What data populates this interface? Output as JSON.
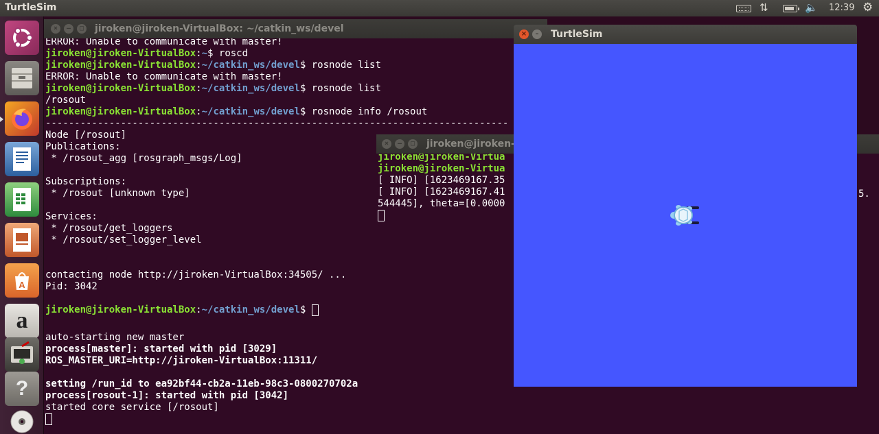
{
  "top_panel": {
    "app_title": "TurtleSim",
    "clock": "12:39"
  },
  "launcher": {
    "items": [
      {
        "name": "ubuntu-dash-icon"
      },
      {
        "name": "files-icon"
      },
      {
        "name": "firefox-icon"
      },
      {
        "name": "writer-icon"
      },
      {
        "name": "calc-icon"
      },
      {
        "name": "impress-icon"
      },
      {
        "name": "software-center-icon"
      },
      {
        "name": "amazon-icon"
      },
      {
        "name": "system-settings-icon"
      },
      {
        "name": "help-icon"
      },
      {
        "name": "dvd-icon"
      }
    ],
    "amazon_glyph": "a",
    "help_glyph": "?"
  },
  "terminal_main": {
    "title": "jiroken@jiroken-VirtualBox: ~/catkin_ws/devel",
    "user_host": "jiroken@jiroken-VirtualBox",
    "lines": [
      {
        "type": "text",
        "text": "ERROR: Unable to communicate with master!"
      },
      {
        "type": "prompt",
        "path": "~",
        "cmd": " roscd"
      },
      {
        "type": "prompt",
        "path": "~/catkin_ws/devel",
        "cmd": " rosnode list"
      },
      {
        "type": "text",
        "text": "ERROR: Unable to communicate with master!"
      },
      {
        "type": "prompt",
        "path": "~/catkin_ws/devel",
        "cmd": " rosnode list"
      },
      {
        "type": "text",
        "text": "/rosout"
      },
      {
        "type": "prompt",
        "path": "~/catkin_ws/devel",
        "cmd": " rosnode info /rosout"
      },
      {
        "type": "text",
        "text": "--------------------------------------------------------------------------------"
      },
      {
        "type": "text",
        "text": "Node [/rosout]"
      },
      {
        "type": "text",
        "text": "Publications:"
      },
      {
        "type": "text",
        "text": " * /rosout_agg [rosgraph_msgs/Log]"
      },
      {
        "type": "text",
        "text": ""
      },
      {
        "type": "text",
        "text": "Subscriptions:"
      },
      {
        "type": "text",
        "text": " * /rosout [unknown type]"
      },
      {
        "type": "text",
        "text": ""
      },
      {
        "type": "text",
        "text": "Services:"
      },
      {
        "type": "text",
        "text": " * /rosout/get_loggers"
      },
      {
        "type": "text",
        "text": " * /rosout/set_logger_level"
      },
      {
        "type": "text",
        "text": ""
      },
      {
        "type": "text",
        "text": ""
      },
      {
        "type": "text",
        "text": "contacting node http://jiroken-VirtualBox:34505/ ..."
      },
      {
        "type": "text",
        "text": "Pid: 3042"
      },
      {
        "type": "text",
        "text": ""
      },
      {
        "type": "prompt-cursor",
        "path": "~/catkin_ws/devel",
        "cmd": " "
      }
    ]
  },
  "terminal_roscore": {
    "lines": [
      {
        "type": "text",
        "text": "auto-starting new master"
      },
      {
        "type": "bold",
        "text": "process[master]: started with pid [3029]"
      },
      {
        "type": "bold",
        "text": "ROS_MASTER_URI=http://jiroken-VirtualBox:11311/"
      },
      {
        "type": "text",
        "text": ""
      },
      {
        "type": "bold",
        "text": "setting /run_id to ea92bf44-cb2a-11eb-98c3-0800270702a"
      },
      {
        "type": "bold",
        "text": "process[rosout-1]: started with pid [3042]"
      },
      {
        "type": "text",
        "text": "started core service [/rosout]"
      },
      {
        "type": "cursor",
        "text": ""
      }
    ]
  },
  "terminal_turtle": {
    "title": "jiroken@jiroken-VirtualBox: ~",
    "lines": [
      {
        "type": "green",
        "text": "jiroken@jiroken-Virtua"
      },
      {
        "type": "green",
        "text": "jiroken@jiroken-Virtua"
      },
      {
        "type": "text",
        "text": "[ INFO] [1623469167.35"
      },
      {
        "type": "text",
        "text": "[ INFO] [1623469167.41"
      },
      {
        "type": "text",
        "text": "544445], theta=[0.0000"
      },
      {
        "type": "cursor",
        "text": ""
      }
    ],
    "overflow_right": "5."
  },
  "turtlesim": {
    "title": "TurtleSim",
    "turtle_x": 5.544445,
    "turtle_y": 5.544445,
    "canvas_color": "#4556ff"
  }
}
